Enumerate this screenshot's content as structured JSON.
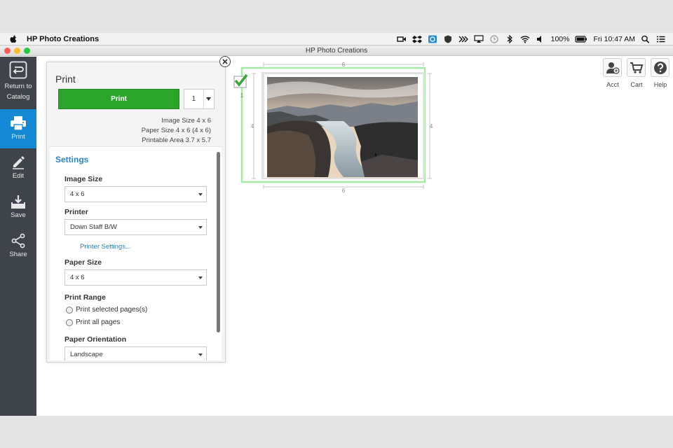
{
  "menubar": {
    "app_name": "HP Photo Creations",
    "battery": "100%",
    "clock": "Fri 10:47 AM"
  },
  "window": {
    "title": "HP Photo Creations"
  },
  "rail": {
    "items": [
      {
        "label": "Return to Catalog",
        "icon": "return-icon"
      },
      {
        "label": "Print",
        "icon": "printer-icon"
      },
      {
        "label": "Edit",
        "icon": "pencil-icon"
      },
      {
        "label": "Save",
        "icon": "save-icon"
      },
      {
        "label": "Share",
        "icon": "share-icon"
      }
    ]
  },
  "print_panel": {
    "title": "Print",
    "print_button": "Print",
    "copies": "1",
    "image_size_info": "Image Size 4 x 6",
    "paper_size_info": "Paper Size 4 x 6 (4 x 6)",
    "printable_area_info": "Printable Area 3.7 x 5.7",
    "settings_title": "Settings",
    "image_size_label": "Image Size",
    "image_size_value": "4 x 6",
    "printer_label": "Printer",
    "printer_value": "Down Staff B/W",
    "printer_settings_link": "Printer Settings...",
    "paper_size_label": "Paper Size",
    "paper_size_value": "4 x 6",
    "print_range_label": "Print Range",
    "print_range_options": [
      "Print selected pages(s)",
      "Print all pages"
    ],
    "orientation_label": "Paper Orientation",
    "orientation_value": "Landscape"
  },
  "canvas": {
    "page_number": "1",
    "dim_top": "6",
    "dim_bottom": "6",
    "dim_left": "4",
    "dim_right": "4"
  },
  "top_icons": [
    {
      "label": "Acct",
      "icon": "account-icon"
    },
    {
      "label": "Cart",
      "icon": "cart-icon"
    },
    {
      "label": "Help",
      "icon": "help-icon"
    }
  ],
  "colors": {
    "accent_blue": "#1689d5",
    "print_green": "#2aa52a",
    "rail_dark": "#3f434a",
    "selection_green": "#8fe08f"
  }
}
